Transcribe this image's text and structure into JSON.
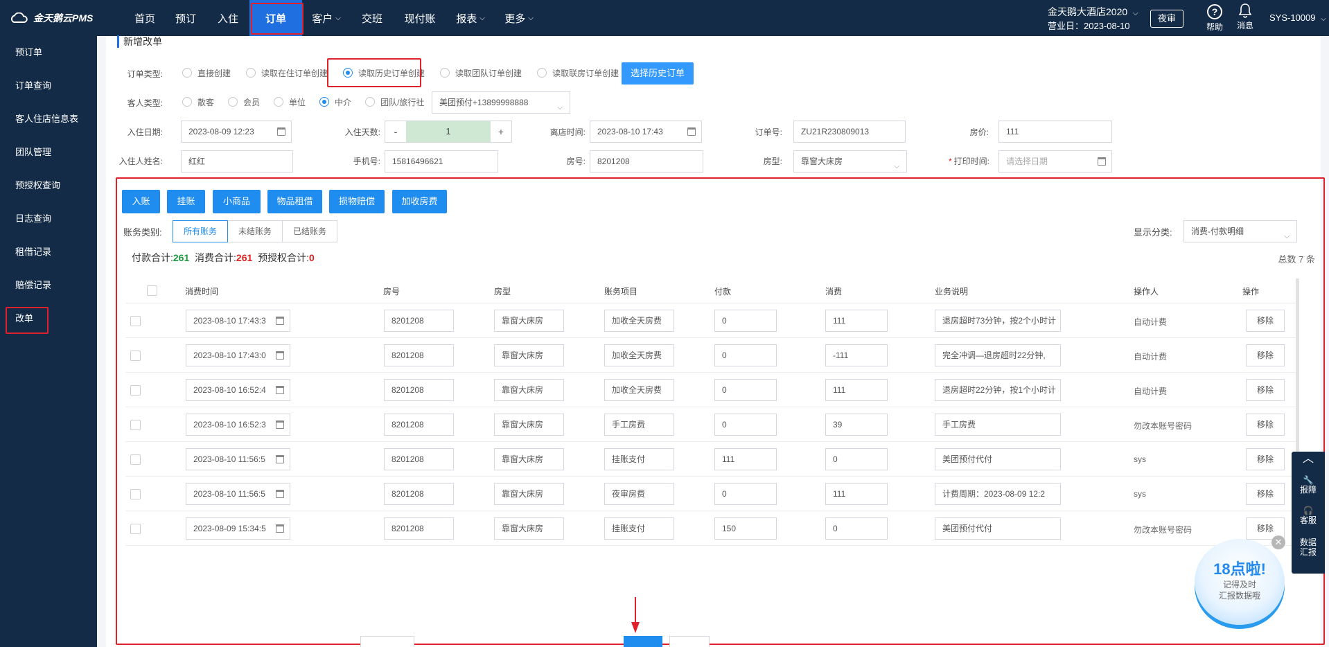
{
  "brand": {
    "name": "金天鹅云PMS"
  },
  "nav": [
    {
      "label": "首页",
      "dropdown": false,
      "active": false
    },
    {
      "label": "预订",
      "dropdown": false,
      "active": false
    },
    {
      "label": "入住",
      "dropdown": false,
      "active": false
    },
    {
      "label": "订单",
      "dropdown": false,
      "active": true
    },
    {
      "label": "客户",
      "dropdown": true,
      "active": false
    },
    {
      "label": "交班",
      "dropdown": false,
      "active": false
    },
    {
      "label": "现付账",
      "dropdown": false,
      "active": false
    },
    {
      "label": "报表",
      "dropdown": true,
      "active": false
    },
    {
      "label": "更多",
      "dropdown": true,
      "active": false
    }
  ],
  "header": {
    "hotel_name": "金天鹅大酒店2020",
    "business_day": "营业日：2023-08-10",
    "night_audit": "夜审",
    "help": "帮助",
    "messages": "消息",
    "user": "SYS-10009"
  },
  "sidebar": {
    "items": [
      "预订单",
      "订单查询",
      "客人住店信息表",
      "团队管理",
      "预授权查询",
      "日志查询",
      "租借记录",
      "赔偿记录",
      "改单"
    ],
    "active_index": 8
  },
  "form": {
    "section_title": "新增改单",
    "order_type_label": "订单类型:",
    "order_types": [
      "直接创建",
      "读取在住订单创建",
      "读取历史订单创建",
      "读取团队订单创建",
      "读取联房订单创建"
    ],
    "order_type_selected": 2,
    "select_history_button": "选择历史订单",
    "guest_type_label": "客人类型:",
    "guest_types": [
      "散客",
      "会员",
      "单位",
      "中介",
      "团队/旅行社"
    ],
    "guest_type_selected": 3,
    "agency_value": "美团预付+13899998888",
    "checkin_date_label": "入住日期:",
    "checkin_date": "2023-08-09 12:23",
    "nights_label": "入住天数:",
    "nights_minus": "-",
    "nights_value": "1",
    "nights_plus": "+",
    "checkout_label": "离店时间:",
    "checkout_time": "2023-08-10 17:43",
    "order_no_label": "订单号:",
    "order_no": "ZU21R230809013",
    "price_label": "房价:",
    "price": "111",
    "guest_name_label": "入住人姓名:",
    "guest_name": "红红",
    "phone_label": "手机号:",
    "phone": "15816496621",
    "room_no_label": "房号:",
    "room_no": "8201208",
    "room_type_label": "房型:",
    "room_type": "靠窗大床房",
    "print_time_label": "打印时间:",
    "print_time_placeholder": "请选择日期"
  },
  "toolbar": [
    "入账",
    "挂账",
    "小商品",
    "物品租借",
    "损物赔偿",
    "加收房费"
  ],
  "ledger": {
    "category_label": "账务类别:",
    "categories": [
      "所有账务",
      "未结账务",
      "已结账务"
    ],
    "category_selected": 0,
    "display_label": "显示分类:",
    "display_value": "消费-付款明细",
    "pay_total_label": "付款合计:",
    "pay_total": "261",
    "consume_total_label": "消费合计:",
    "consume_total": "261",
    "preauth_total_label": "预授权合计:",
    "preauth_total": "0",
    "count_text": "总数 7 条"
  },
  "table": {
    "columns": [
      "消费时间",
      "房号",
      "房型",
      "账务项目",
      "付款",
      "消费",
      "业务说明",
      "操作人",
      "操作"
    ],
    "remove_label": "移除",
    "rows": [
      {
        "time": "2023-08-10 17:43:3",
        "room": "8201208",
        "type": "靠窗大床房",
        "item": "加收全天房费",
        "pay": "0",
        "consume": "111",
        "desc": "退房超时73分钟，按2个小时计",
        "operator": "自动计费"
      },
      {
        "time": "2023-08-10 17:43:0",
        "room": "8201208",
        "type": "靠窗大床房",
        "item": "加收全天房费",
        "pay": "0",
        "consume": "-111",
        "desc": "完全冲调—退房超时22分钟,",
        "operator": "自动计费"
      },
      {
        "time": "2023-08-10 16:52:4",
        "room": "8201208",
        "type": "靠窗大床房",
        "item": "加收全天房费",
        "pay": "0",
        "consume": "111",
        "desc": "退房超时22分钟，按1个小时计",
        "operator": "自动计费"
      },
      {
        "time": "2023-08-10 16:52:3",
        "room": "8201208",
        "type": "靠窗大床房",
        "item": "手工房费",
        "pay": "0",
        "consume": "39",
        "desc": "手工房费",
        "operator": "勿改本账号密码"
      },
      {
        "time": "2023-08-10 11:56:5",
        "room": "8201208",
        "type": "靠窗大床房",
        "item": "挂账支付",
        "pay": "111",
        "consume": "0",
        "desc": "美团预付代付",
        "operator": "sys"
      },
      {
        "time": "2023-08-10 11:56:5",
        "room": "8201208",
        "type": "靠窗大床房",
        "item": "夜审房费",
        "pay": "0",
        "consume": "111",
        "desc": "计费周期：2023-08-09 12:2",
        "operator": "sys"
      },
      {
        "time": "2023-08-09 15:34:5",
        "room": "8201208",
        "type": "靠窗大床房",
        "item": "挂账支付",
        "pay": "150",
        "consume": "0",
        "desc": "美团预付代付",
        "operator": "勿改本账号密码"
      }
    ]
  },
  "float_panel": [
    "报障",
    "客服",
    "数据汇报"
  ],
  "ad": {
    "title": "18点啦!",
    "line1": "记得及时",
    "line2": "汇报数据哦"
  },
  "colors": {
    "nav_bg": "#132b47",
    "accent": "#1f8cf0",
    "highlight": "#e0212b"
  }
}
